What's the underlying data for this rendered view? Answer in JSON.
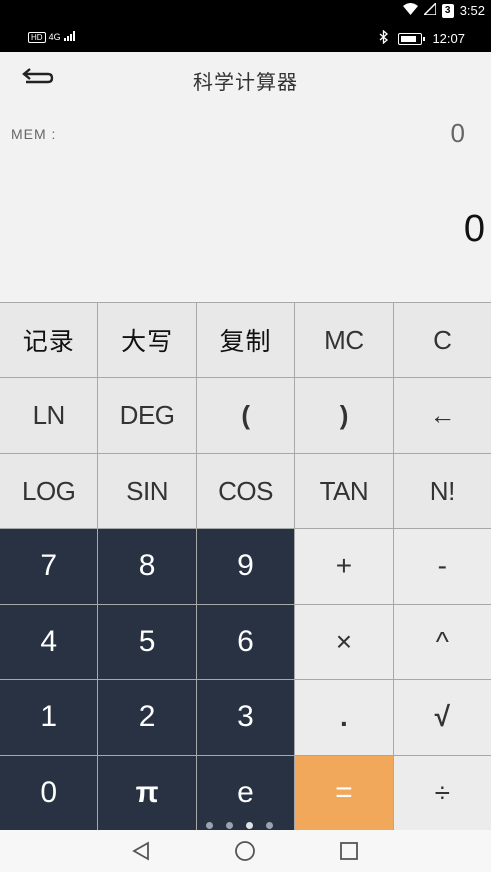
{
  "outer_status": {
    "badge": "3",
    "time": "3:52"
  },
  "inner_status": {
    "hd": "HD",
    "network": "4G",
    "time": "12:07"
  },
  "header": {
    "title": "科学计算器"
  },
  "display": {
    "mem_label": "MEM :",
    "mem_value": "0",
    "result": "0"
  },
  "keys": {
    "r1": [
      "记录",
      "大写",
      "复制",
      "MC",
      "C"
    ],
    "r2": [
      "LN",
      "DEG",
      "(",
      ")",
      "←"
    ],
    "r3": [
      "LOG",
      "SIN",
      "COS",
      "TAN",
      "N!"
    ],
    "r4": [
      "7",
      "8",
      "9",
      "+",
      "-"
    ],
    "r5": [
      "4",
      "5",
      "6",
      "×",
      "^"
    ],
    "r6": [
      "1",
      "2",
      "3",
      ".",
      "√"
    ],
    "r7": [
      "0",
      "π",
      "e",
      "=",
      "÷"
    ]
  },
  "colors": {
    "digit_key": "#283242",
    "equals_key": "#f1a85a",
    "function_key": "#e8e8e8"
  }
}
